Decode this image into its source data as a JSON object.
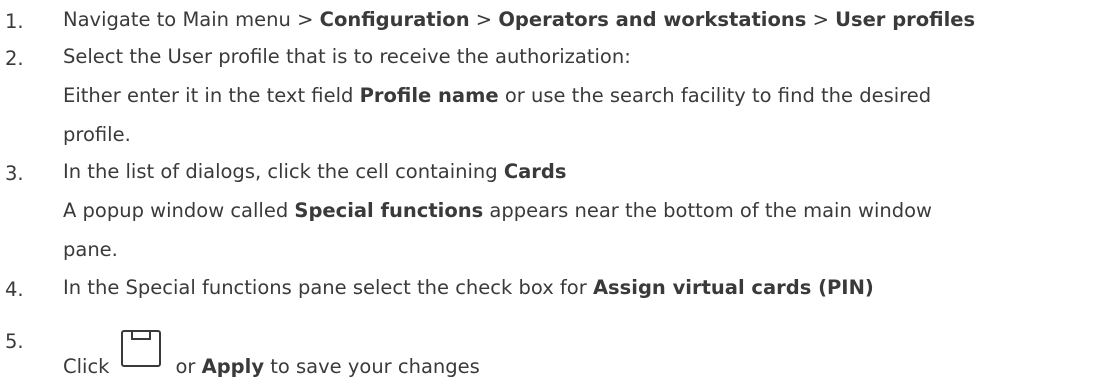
{
  "steps": [
    {
      "number": "1.",
      "prefix": "Navigate to Main menu > ",
      "b1": "Configuration",
      "sep1": " > ",
      "b2": "Operators and workstations",
      "sep2": " > ",
      "b3": "User profiles"
    },
    {
      "number": "2.",
      "line1": "Select the User profile that is to receive the authorization:",
      "line2_pre": "Either enter it in the text field ",
      "line2_bold": "Profile name",
      "line2_post": " or use the search facility to find the desired",
      "line3": "profile."
    },
    {
      "number": "3.",
      "line1_pre": "In the list of dialogs, click the cell containing ",
      "line1_bold": "Cards",
      "line2_pre": "A popup window called ",
      "line2_bold": "Special functions",
      "line2_post": " appears near the bottom of the main window",
      "line3": "pane."
    },
    {
      "number": "4.",
      "pre": "In the Special functions pane select the check box for ",
      "bold": "Assign virtual cards (PIN)"
    },
    {
      "number": "5.",
      "pre": "Click",
      "icon": "save-icon",
      "mid": "or ",
      "bold": "Apply",
      "post": " to save your changes"
    }
  ]
}
